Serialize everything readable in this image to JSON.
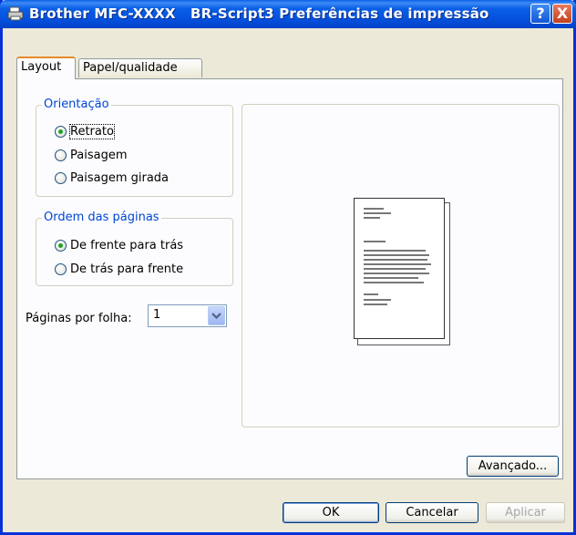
{
  "window": {
    "title": "Brother MFC-XXXX   BR-Script3 Preferências de impressão",
    "help_button": "?",
    "close_button": "X"
  },
  "tabs": [
    {
      "label": "Layout",
      "active": true
    },
    {
      "label": "Papel/qualidade",
      "active": false
    }
  ],
  "orientation": {
    "legend": "Orientação",
    "options": [
      {
        "label": "Retrato",
        "checked": true
      },
      {
        "label": "Paisagem",
        "checked": false
      },
      {
        "label": "Paisagem girada",
        "checked": false
      }
    ]
  },
  "page_order": {
    "legend": "Ordem das páginas",
    "options": [
      {
        "label": "De frente para trás",
        "checked": true
      },
      {
        "label": "De trás para frente",
        "checked": false
      }
    ]
  },
  "pages_per_sheet": {
    "label": "Páginas por folha:",
    "value": "1"
  },
  "buttons": {
    "advanced": "Avançado...",
    "ok": "OK",
    "cancel": "Cancelar",
    "apply": "Aplicar"
  }
}
